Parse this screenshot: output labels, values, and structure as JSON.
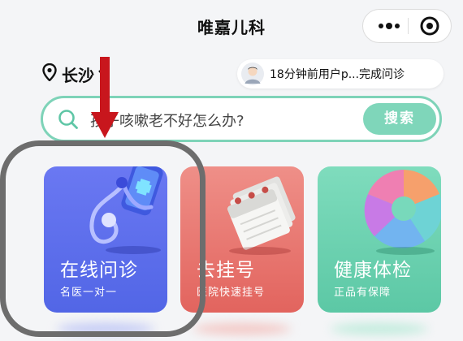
{
  "header": {
    "title": "唯嘉儿科"
  },
  "capsule": {
    "more_icon": "more-dots-icon",
    "close_icon": "target-circle-icon"
  },
  "location": {
    "city": "长沙",
    "icon": "location-pin-icon"
  },
  "notice": {
    "text": "18分钟前用户p...完成问诊",
    "avatar_icon": "user-avatar-icon"
  },
  "search": {
    "query": "孩子咳嗽老不好怎么办?",
    "button_label": "搜索",
    "icon": "search-icon"
  },
  "services": [
    {
      "title": "在线问诊",
      "subtitle": "名医一对一",
      "color": "#5b6cec",
      "icon": "stethoscope-phone-icon"
    },
    {
      "title": "去挂号",
      "subtitle": "医院快速挂号",
      "color": "#e8716b",
      "icon": "calendar-icon"
    },
    {
      "title": "健康体检",
      "subtitle": "正品有保障",
      "color": "#6dd3b1",
      "icon": "pie-chart-icon"
    }
  ],
  "annotation": {
    "arrow_color": "#c8161d",
    "highlight_color": "#6d6d6d"
  }
}
